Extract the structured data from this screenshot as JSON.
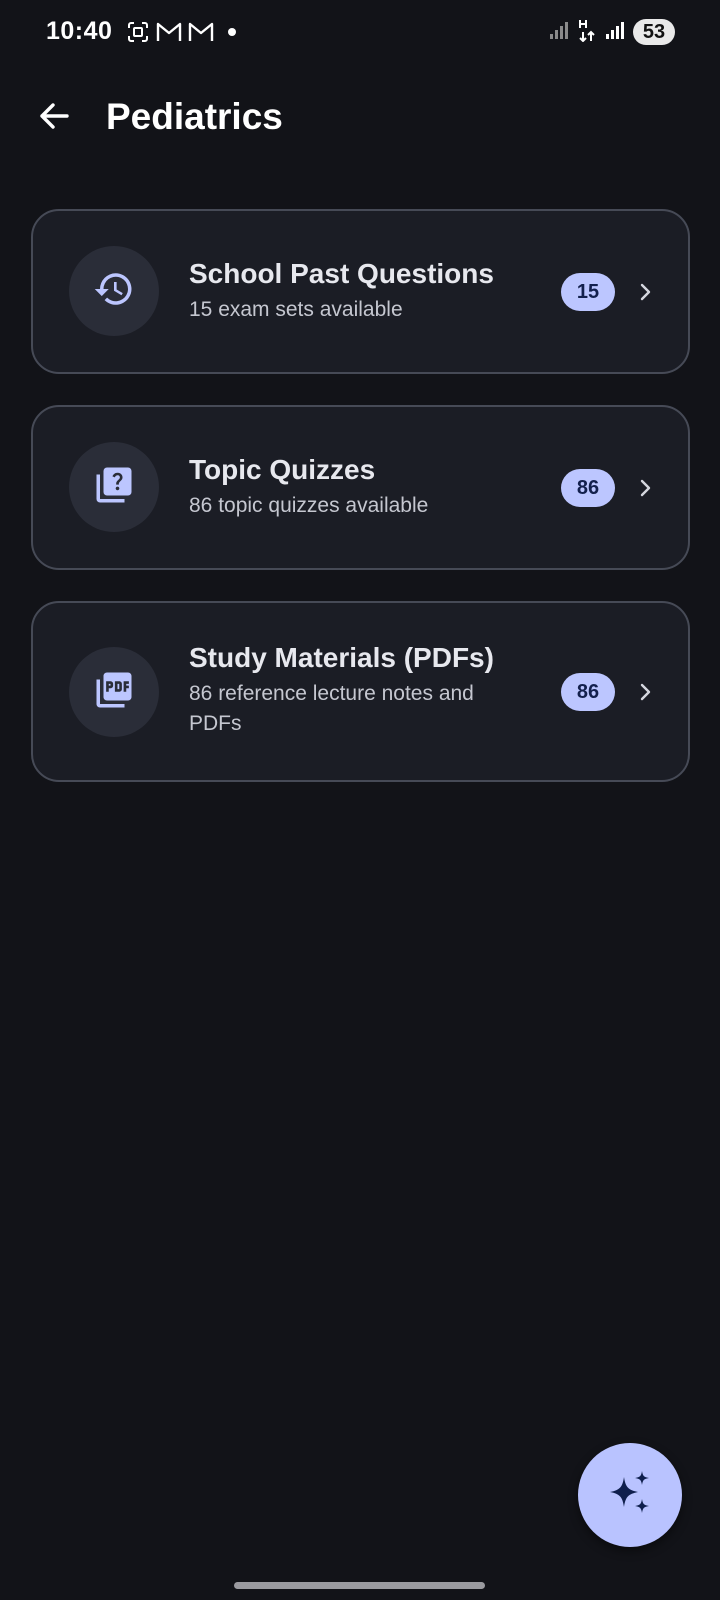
{
  "status_bar": {
    "time": "10:40",
    "battery": "53",
    "icons": [
      "screenshot-icon",
      "gmail-icon",
      "gmail-icon",
      "notification-dot",
      "signal-icon",
      "data-transfer-icon",
      "signal-icon",
      "battery-icon"
    ]
  },
  "app_bar": {
    "back_icon": "arrow-back-icon",
    "title": "Pediatrics"
  },
  "cards": [
    {
      "icon": "history-icon",
      "title": "School Past Questions",
      "subtitle": "15 exam sets available",
      "badge": "15"
    },
    {
      "icon": "quiz-icon",
      "title": "Topic Quizzes",
      "subtitle": "86 topic quizzes available",
      "badge": "86"
    },
    {
      "icon": "pdf-icon",
      "title": "Study Materials (PDFs)",
      "subtitle": "86 reference lecture notes and PDFs",
      "badge": "86"
    }
  ],
  "fab": {
    "icon": "sparkle-icon"
  },
  "colors": {
    "background": "#121318",
    "card_background": "#1b1d25",
    "card_border": "#464a56",
    "accent": "#b9c3ff",
    "badge_text": "#13204d",
    "icon_tint": "#bcc6ff"
  }
}
